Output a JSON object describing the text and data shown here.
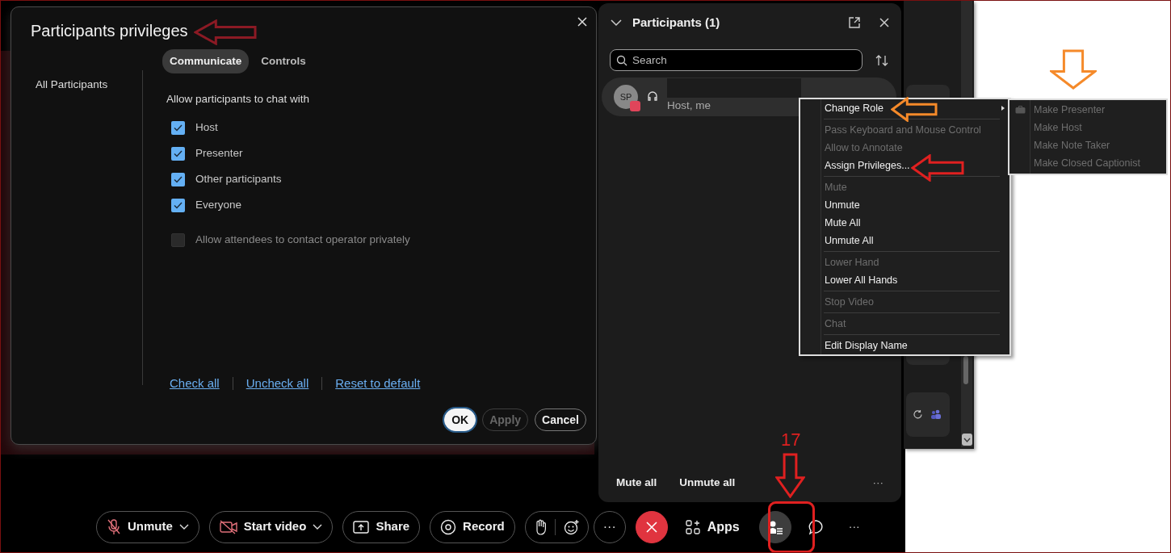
{
  "dialog": {
    "title": "Participants privileges",
    "tabs": [
      {
        "label": "Communicate",
        "selected": true
      },
      {
        "label": "Controls",
        "selected": false
      }
    ],
    "sidebar": {
      "items": [
        {
          "label": "All Participants"
        }
      ]
    },
    "section_title": "Allow participants to chat with",
    "options": [
      {
        "label": "Host",
        "checked": true,
        "disabled": false
      },
      {
        "label": "Presenter",
        "checked": true,
        "disabled": false
      },
      {
        "label": "Other participants",
        "checked": true,
        "disabled": false
      },
      {
        "label": "Everyone",
        "checked": true,
        "disabled": false
      },
      {
        "label": "Allow attendees to contact operator privately",
        "checked": false,
        "disabled": true
      }
    ],
    "links": [
      "Check all",
      "Uncheck all",
      "Reset to default"
    ],
    "buttons": [
      {
        "label": "OK",
        "kind": "primary",
        "disabled": false
      },
      {
        "label": "Apply",
        "kind": "secondary",
        "disabled": true
      },
      {
        "label": "Cancel",
        "kind": "secondary",
        "disabled": false
      }
    ]
  },
  "participants_panel": {
    "title": "Participants (1)",
    "search": {
      "placeholder": "Search"
    },
    "participants": [
      {
        "initials": "SP",
        "role": "Host, me"
      }
    ],
    "footer_buttons": [
      "Mute all",
      "Unmute all"
    ],
    "more": "···"
  },
  "context_menu": {
    "items": [
      {
        "kind": "item",
        "label": "Change Role",
        "disabled": false,
        "submenu": true
      },
      {
        "kind": "separator"
      },
      {
        "kind": "item",
        "label": "Pass Keyboard and Mouse Control",
        "disabled": true,
        "submenu": false
      },
      {
        "kind": "item",
        "label": "Allow to Annotate",
        "disabled": true,
        "submenu": false
      },
      {
        "kind": "item",
        "label": "Assign Privileges...",
        "disabled": false,
        "submenu": false
      },
      {
        "kind": "separator"
      },
      {
        "kind": "item",
        "label": "Mute",
        "disabled": true,
        "submenu": false
      },
      {
        "kind": "item",
        "label": "Unmute",
        "disabled": false,
        "submenu": false
      },
      {
        "kind": "item",
        "label": "Mute All",
        "disabled": false,
        "submenu": false
      },
      {
        "kind": "item",
        "label": "Unmute All",
        "disabled": false,
        "submenu": false
      },
      {
        "kind": "separator"
      },
      {
        "kind": "item",
        "label": "Lower Hand",
        "disabled": true,
        "submenu": false
      },
      {
        "kind": "item",
        "label": "Lower All Hands",
        "disabled": false,
        "submenu": false
      },
      {
        "kind": "separator"
      },
      {
        "kind": "item",
        "label": "Stop Video",
        "disabled": true,
        "submenu": false
      },
      {
        "kind": "separator"
      },
      {
        "kind": "item",
        "label": "Chat",
        "disabled": true,
        "submenu": false
      },
      {
        "kind": "separator"
      },
      {
        "kind": "item",
        "label": "Edit Display Name",
        "disabled": false,
        "submenu": false
      }
    ]
  },
  "submenu": {
    "items": [
      {
        "label": "Make Presenter",
        "disabled": true
      },
      {
        "label": "Make Host",
        "disabled": true
      },
      {
        "label": "Make Note Taker",
        "disabled": true
      },
      {
        "label": "Make Closed Captionist",
        "disabled": true
      }
    ]
  },
  "toolbar": {
    "items": [
      {
        "kind": "split",
        "label": "Unmute"
      },
      {
        "kind": "split",
        "label": "Start video"
      },
      {
        "kind": "pill",
        "label": "Share"
      },
      {
        "kind": "pill",
        "label": "Record"
      },
      {
        "kind": "reactions"
      },
      {
        "kind": "more",
        "label": "···"
      },
      {
        "kind": "leave"
      },
      {
        "kind": "plain",
        "label": "Apps"
      },
      {
        "kind": "active"
      },
      {
        "kind": "icon"
      },
      {
        "kind": "ellipsis",
        "label": "···"
      }
    ]
  },
  "annotation": {
    "label": "17"
  }
}
